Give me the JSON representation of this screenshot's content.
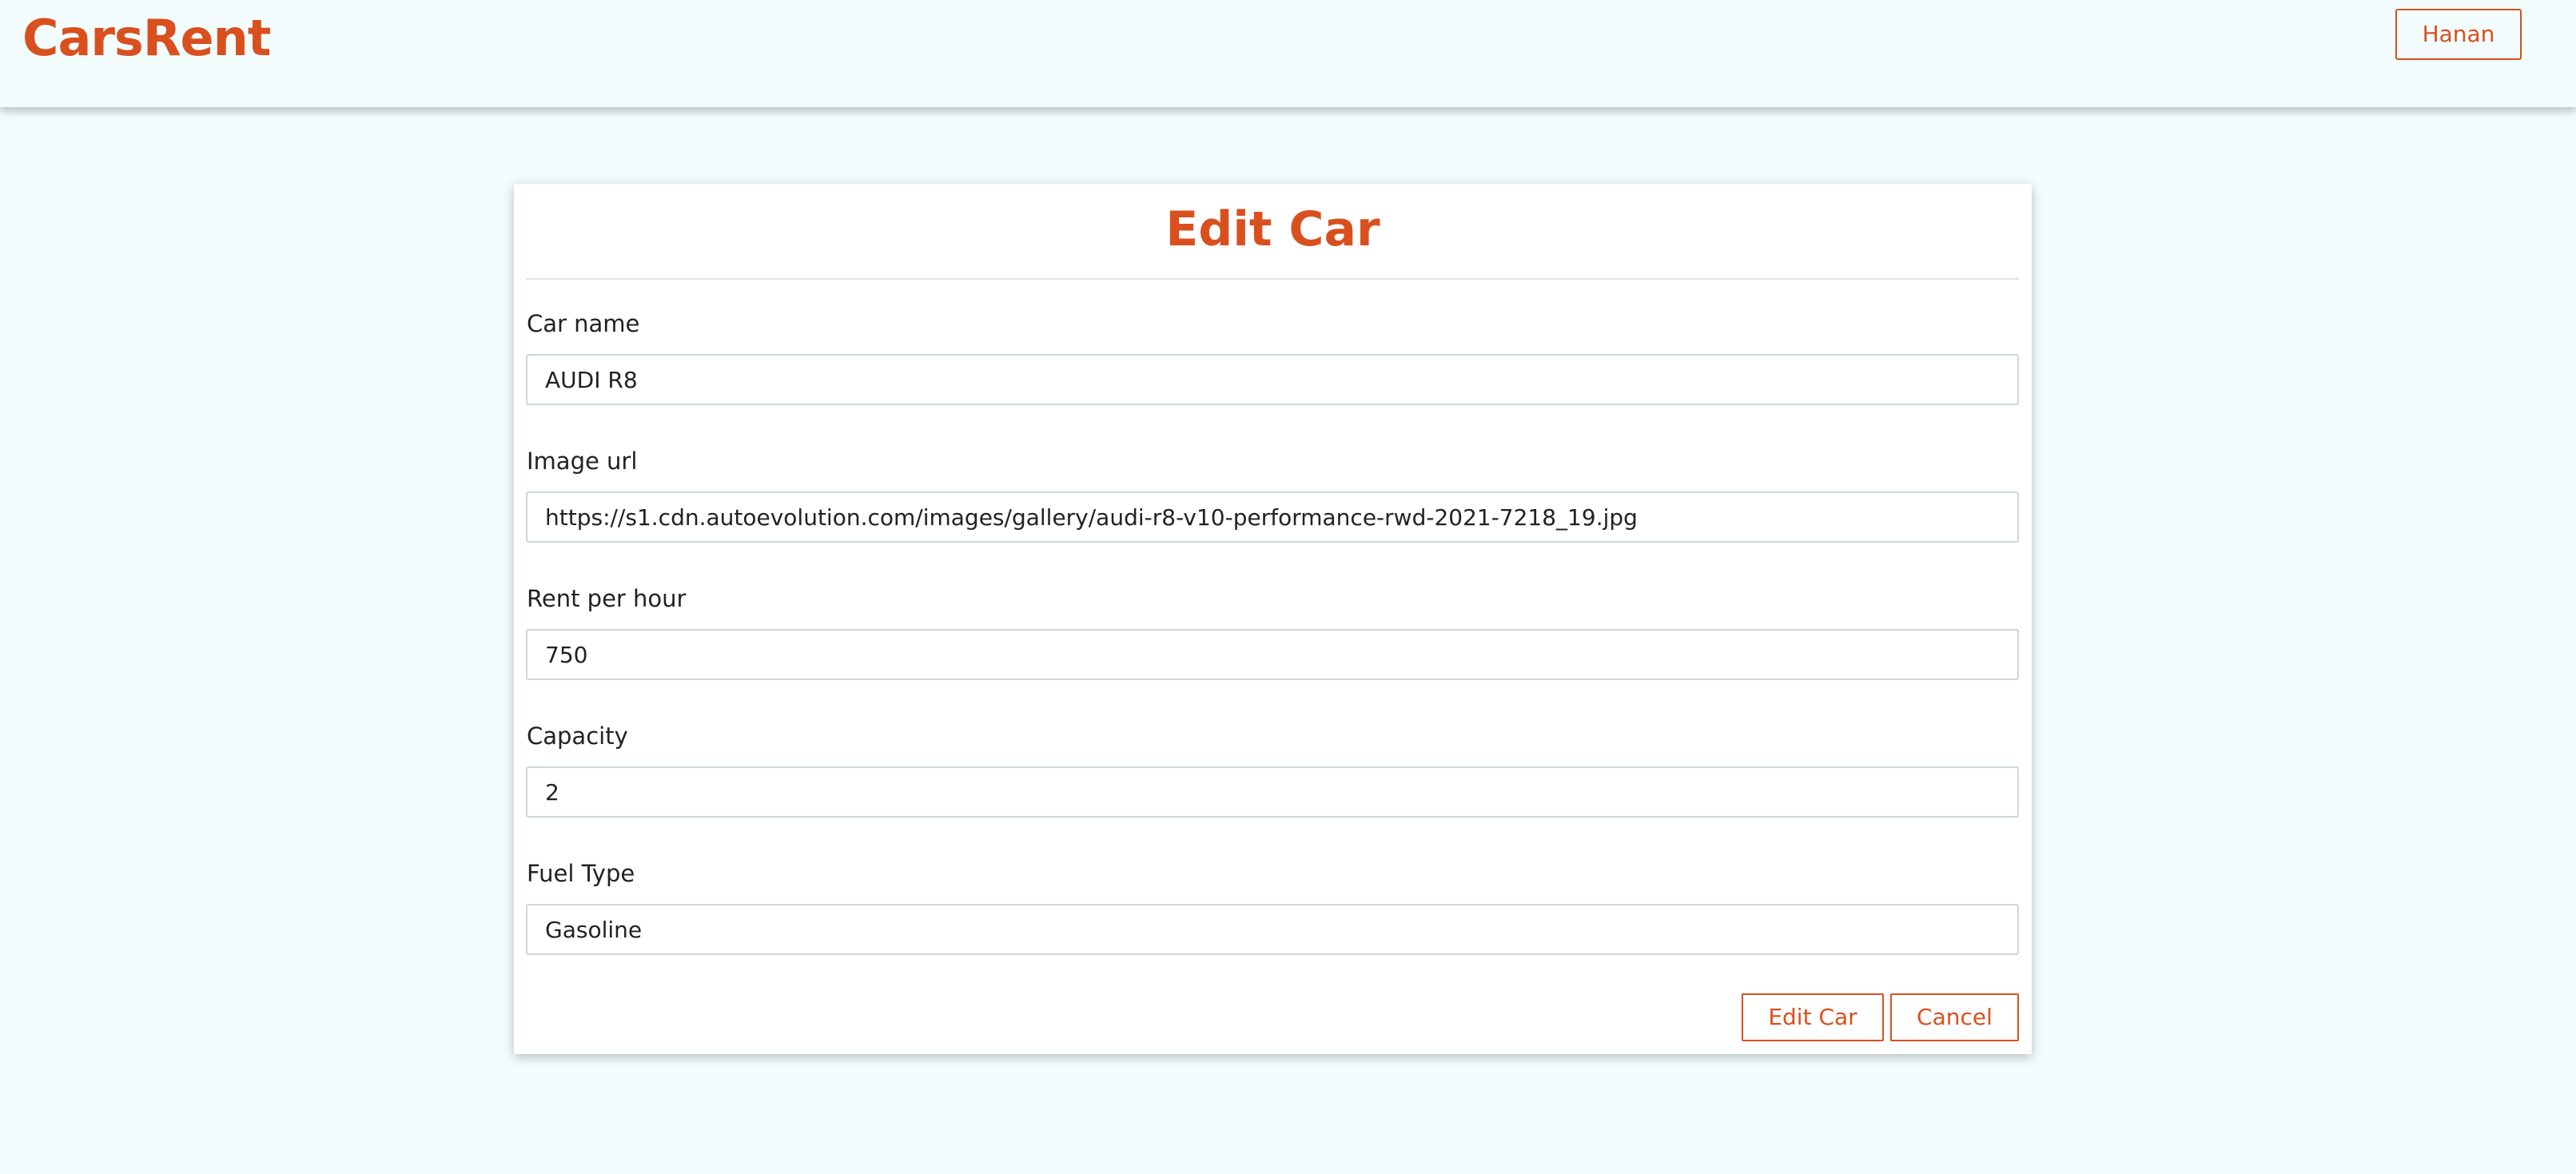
{
  "header": {
    "brand": "CarsRent",
    "user_button": "Hanan"
  },
  "form": {
    "title": "Edit Car",
    "fields": [
      {
        "label": "Car name",
        "value": "AUDI R8"
      },
      {
        "label": "Image url",
        "value": "https://s1.cdn.autoevolution.com/images/gallery/audi-r8-v10-performance-rwd-2021-7218_19.jpg"
      },
      {
        "label": "Rent per hour",
        "value": "750"
      },
      {
        "label": "Capacity",
        "value": "2"
      },
      {
        "label": "Fuel Type",
        "value": "Gasoline"
      }
    ],
    "submit_label": "Edit Car",
    "cancel_label": "Cancel"
  },
  "colors": {
    "accent": "#d9501e",
    "background": "#f3fdfd",
    "card": "#ffffff"
  }
}
